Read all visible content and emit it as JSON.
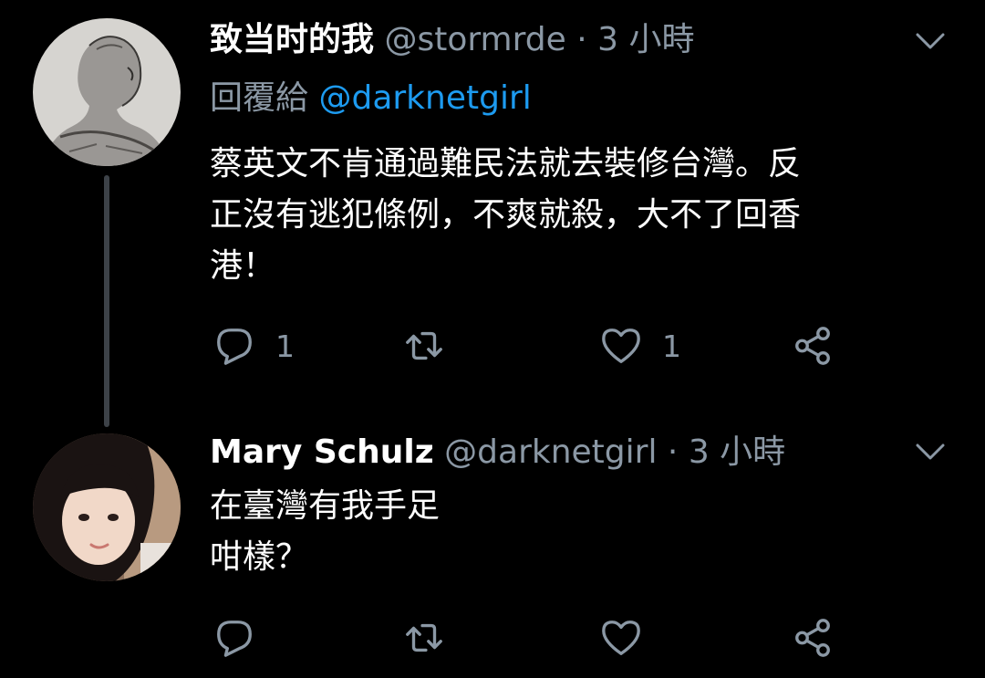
{
  "tweets": [
    {
      "author_name": "致当时的我",
      "handle": "@stormrde",
      "separator": "·",
      "time": "3 小時",
      "reply_prefix": "回覆給",
      "reply_mention": "@darknetgirl",
      "body_lines": [
        "蔡英文不肯通過難民法就去裝修台灣。反",
        "正沒有逃犯條例，不爽就殺，大不了回香",
        "港！"
      ],
      "reply_count": "1",
      "retweet_count": "",
      "like_count": "1"
    },
    {
      "author_name": "Mary Schulz",
      "handle": "@darknetgirl",
      "separator": "·",
      "time": "3 小時",
      "body_lines": [
        "在臺灣有我手足",
        "咁樣？"
      ],
      "reply_count": "",
      "retweet_count": "",
      "like_count": ""
    }
  ],
  "icons": {
    "reply": "reply-icon",
    "retweet": "retweet-icon",
    "like": "heart-icon",
    "share": "share-icon",
    "more": "chevron-down-icon"
  },
  "colors": {
    "background": "#000000",
    "text": "#ffffff",
    "secondary": "#8b98a5",
    "mention": "#1d9bf0",
    "thread_line": "#3d4248"
  }
}
